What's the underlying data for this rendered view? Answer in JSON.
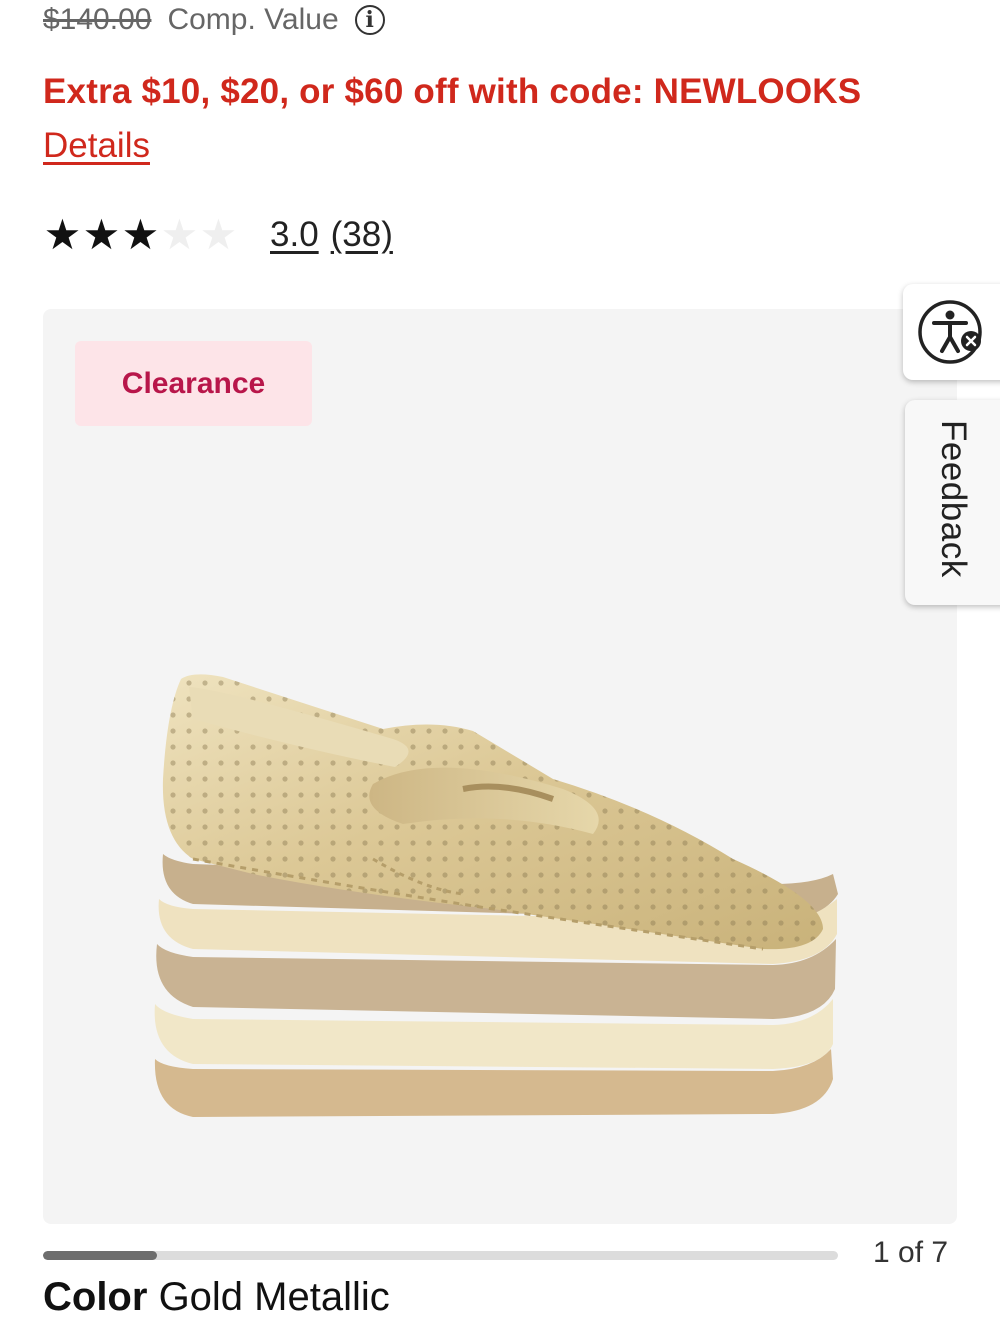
{
  "price": {
    "comp_value_price": "$140.00",
    "comp_value_label": "Comp. Value",
    "info_glyph": "i"
  },
  "promo": {
    "text": "Extra $10, $20, or $60 off with code: NEWLOOKS",
    "details_label": "Details"
  },
  "rating": {
    "value": "3.0",
    "count": "(38)",
    "filled_stars": 3,
    "total_stars": 5
  },
  "product": {
    "badge": "Clearance",
    "image_icon": "gold-metallic-platform-loafer-image"
  },
  "sidebar": {
    "accessibility_icon": "accessibility-icon",
    "feedback_label": "Feedback"
  },
  "carousel": {
    "counter": "1 of 7",
    "progress": 0.143
  },
  "color": {
    "label": "Color",
    "value": "Gold Metallic"
  },
  "colors": {
    "promo_red": "#d0281c",
    "badge_bg": "#fde4e8",
    "badge_text": "#b8164a"
  }
}
